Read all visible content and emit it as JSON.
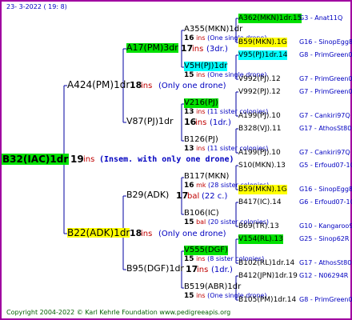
{
  "header": {
    "date": "23-  3-2022 ( 19:  8)"
  },
  "footer": {
    "copyright": "Copyright 2004-2022 © Karl Kehrle Foundation   www.pedigreeapis.org"
  },
  "colors": {
    "green": "#00e000",
    "yellow": "#ffff00",
    "cyan": "#00ffff",
    "border": "#a000a0",
    "line": "#0000a0",
    "ins": "#c00000",
    "note": "#0000c0"
  },
  "root": {
    "name": "B32(IAC)1dr",
    "ins": "19",
    "note": "(Insem. with only one drone)"
  },
  "gen1": [
    {
      "name": "A424(PM)1dr",
      "ins": "18",
      "note": "(Only one drone)"
    },
    {
      "name": "B22(ADK)1dr",
      "ins": "18",
      "note": "(Only one drone)"
    }
  ],
  "gen2": [
    {
      "name": "A17(PM)3dr",
      "ins": "17",
      "note": "(3dr.)"
    },
    {
      "name": "V87(PJ)1dr",
      "ins": "16",
      "note": "(1dr.)"
    },
    {
      "name": "B29(ADK)",
      "ins": "17",
      "note": "(22 c.)",
      "ins_label": "bal"
    },
    {
      "name": "B95(DGF)1dr",
      "ins": "17",
      "note": "(1dr.)"
    }
  ],
  "gen3": [
    {
      "name": "A355(MKN)1dr",
      "ins": "16",
      "note": "(One single drone)"
    },
    {
      "name": "V5H(PJ)1dr",
      "ins": "15",
      "note": "(One single drone)"
    },
    {
      "name": "V216(PJ)",
      "ins": "13",
      "note": "(11 sister colonies)"
    },
    {
      "name": "B126(PJ)",
      "ins": "13",
      "note": "(11 sister colonies)"
    },
    {
      "name": "B117(MKN)",
      "ins": "16",
      "note": "(28 sister colonies)",
      "ins_label": "mk"
    },
    {
      "name": "B106(IC)",
      "ins": "15",
      "note": "(20 sister colonies)",
      "ins_label": "bal"
    },
    {
      "name": "V555(DGF)",
      "ins": "15",
      "note": "(8 sister colonies)"
    },
    {
      "name": "B519(ABR)1dr",
      "ins": "15",
      "note": "(One single drone)"
    }
  ],
  "gen4": [
    {
      "name": "A362(MKN)1dr.15",
      "extra": "G3 - Anat11Q"
    },
    {
      "name": "B59(MKN).1G",
      "extra": "G16 - SinopEgg86R"
    },
    {
      "name": "V95(PJ)1dr.14",
      "extra": "G8 - PrimGreen00"
    },
    {
      "name": "V992(PJ).12",
      "extra": "G7 - PrimGreen00"
    },
    {
      "name": "V992(PJ).12",
      "extra": "G7 - PrimGreen00"
    },
    {
      "name": "A199(PJ).10",
      "extra": "G7 - Cankiri97Q"
    },
    {
      "name": "B328(VJ).11",
      "extra": "G17 - AthosSt80R"
    },
    {
      "name": "A199(PJ).10",
      "extra": "G7 - Cankiri97Q"
    },
    {
      "name": "S10(MKN).13",
      "extra": "G5 - Erfoud07-1Q"
    },
    {
      "name": "B59(MKN).1G",
      "extra": "G16 - SinopEgg86R"
    },
    {
      "name": "B417(IC).14",
      "extra": "G6 - Erfoud07-1Q"
    },
    {
      "name": "B69(TR).13",
      "extra": "G10 - Kangaroo98R"
    },
    {
      "name": "V154(RL).13",
      "extra": "G25 - Sinop62R"
    },
    {
      "name": "B102(RL)1dr.14",
      "extra": "G17 - AthosSt80R"
    },
    {
      "name": "B412(JPN)1dr.19",
      "extra": "G12 - N06294R"
    },
    {
      "name": "B105(PM)1dr.14",
      "extra": "G8 - PrimGreen00"
    }
  ]
}
